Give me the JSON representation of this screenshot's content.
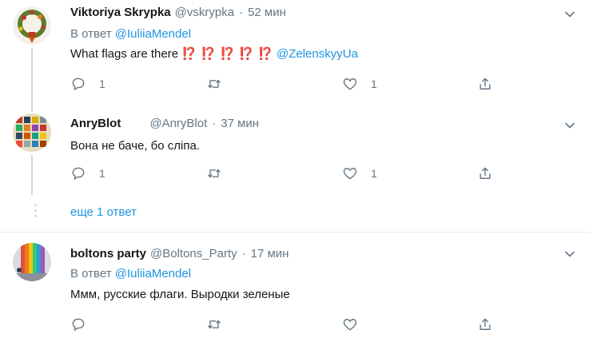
{
  "tweets": [
    {
      "name": "Viktoriya Skrypka",
      "handle": "@vskrypka",
      "dot": "·",
      "time": "52 мин",
      "reply_prefix": "В ответ",
      "reply_to": "@IuliiaMendel",
      "text_before": "What flags are there",
      "interrobangs": "⁉️ ⁉️ ⁉️ ⁉️ ⁉️",
      "mention": "@ZelenskyyUa",
      "reply_count": "1",
      "retweet_count": "",
      "like_count": "1"
    },
    {
      "name": "AnryBlot",
      "handle": "@AnryBlot",
      "dot": "·",
      "time": "37 мин",
      "text": "Вона не баче, бо сліпа.",
      "reply_count": "1",
      "retweet_count": "",
      "like_count": "1"
    },
    {
      "name": "boltons party",
      "handle": "@Boltons_Party",
      "dot": "·",
      "time": "17 мин",
      "reply_prefix": "В ответ",
      "reply_to": "@IuliiaMendel",
      "text": "Ммм, русские флаги. Выродки зеленые",
      "reply_count": "",
      "retweet_count": "",
      "like_count": ""
    }
  ],
  "more_replies": "еще 1 ответ",
  "colors": {
    "link": "#1b95e0",
    "muted": "#657786",
    "text": "#14171a",
    "divider": "#e6ecf0",
    "interrobang": "#b8123b"
  },
  "icons": [
    "reply-icon",
    "retweet-icon",
    "like-icon",
    "share-icon",
    "caret-down-icon"
  ]
}
